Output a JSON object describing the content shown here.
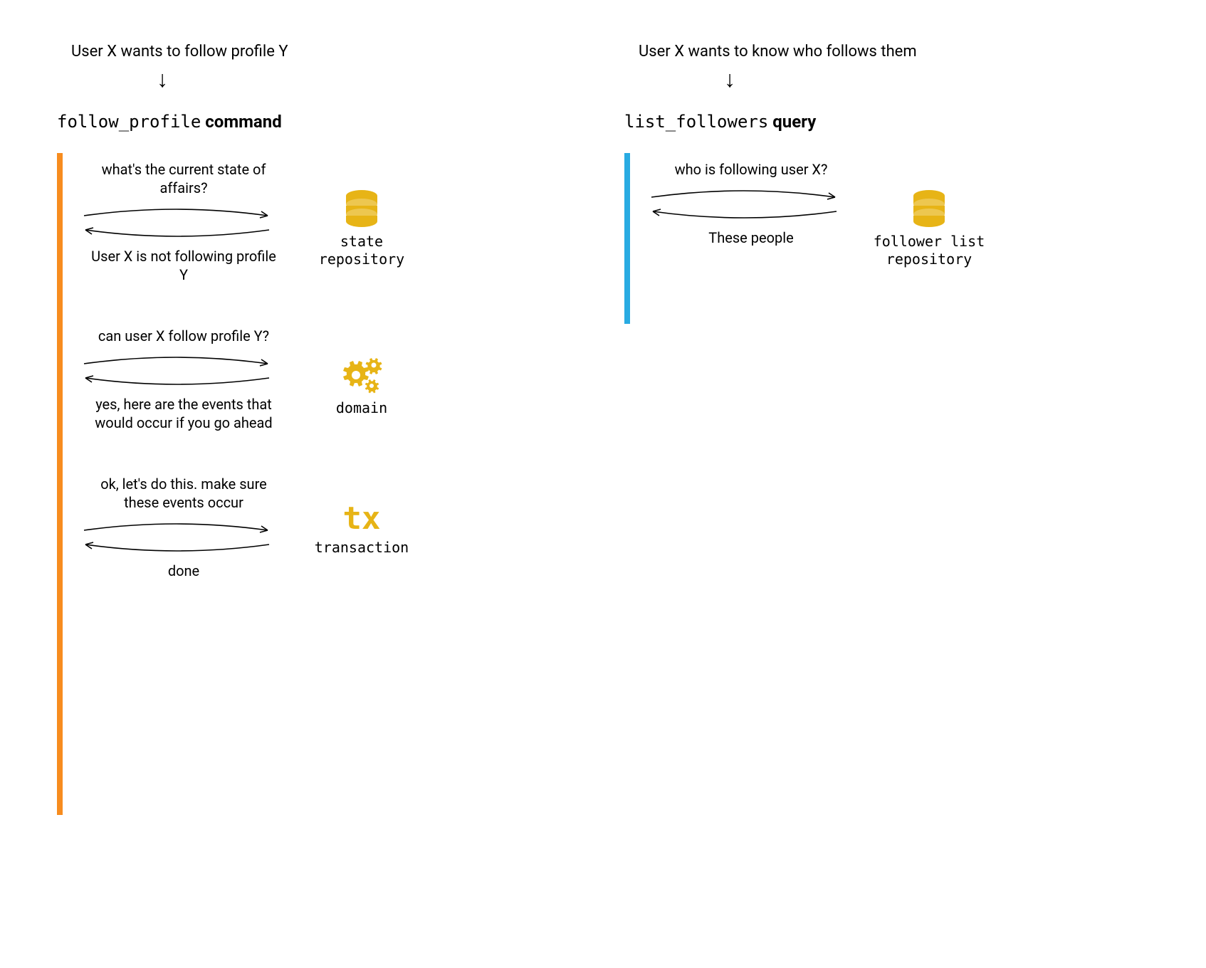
{
  "left": {
    "intent": "User X wants to follow profile Y",
    "heading_code": "follow_profile",
    "heading_kind": " command",
    "bar_color": "orange",
    "steps": [
      {
        "top": "what's the current state of affairs?",
        "bottom": "User X is not following profile Y",
        "target_kind": "db",
        "target_label": "state repository"
      },
      {
        "top": "can user X follow profile Y?",
        "bottom": "yes, here are the events that would occur if you go ahead",
        "target_kind": "gears",
        "target_label": "domain"
      },
      {
        "top": "ok, let's do this. make sure these events occur",
        "bottom": "done",
        "target_kind": "tx",
        "target_glyph": "tx",
        "target_label": "transaction"
      }
    ]
  },
  "right": {
    "intent": "User X wants to know who follows them",
    "heading_code": "list_followers",
    "heading_kind": " query",
    "bar_color": "blue",
    "steps": [
      {
        "top": "who is following user X?",
        "bottom": "These people",
        "target_kind": "db",
        "target_label": "follower list repository"
      }
    ]
  },
  "colors": {
    "accent": "#e7b416",
    "orange": "#f78c1f",
    "blue": "#29abe2"
  }
}
